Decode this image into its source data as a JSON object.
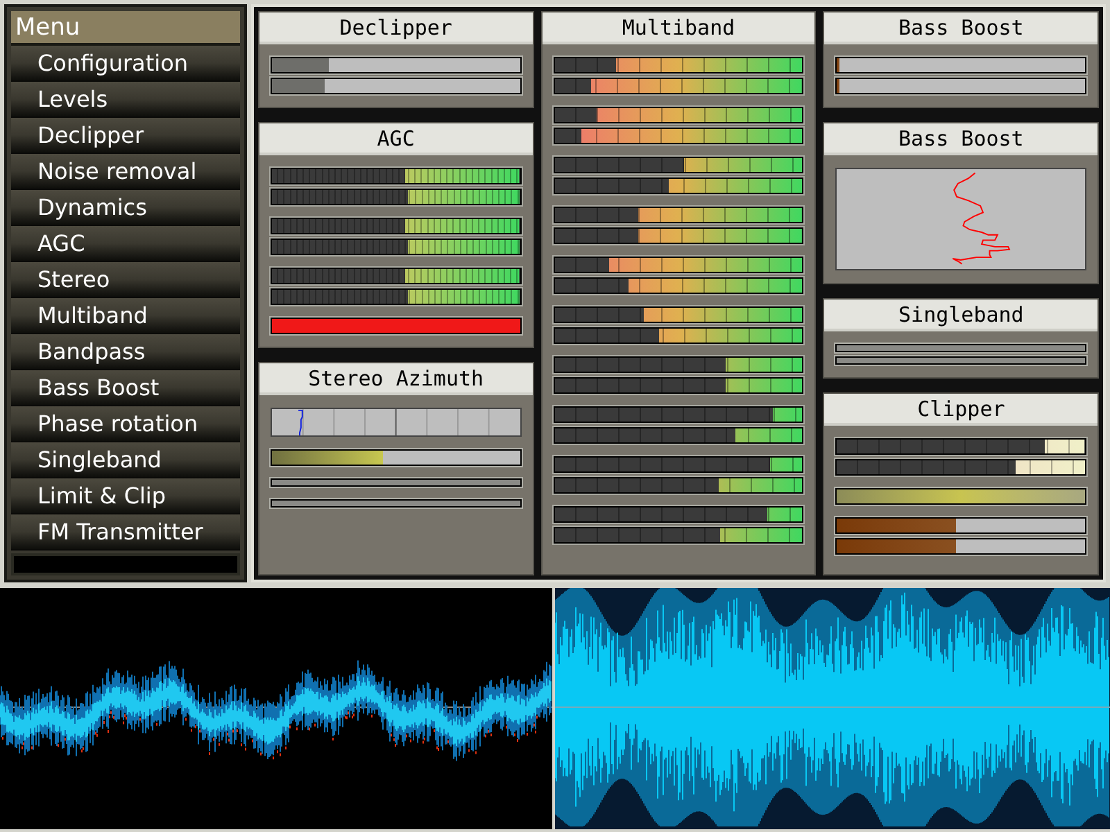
{
  "menu": {
    "title": "Menu",
    "items": [
      "Configuration",
      "Levels",
      "Declipper",
      "Noise removal",
      "Dynamics",
      "AGC",
      "Stereo",
      "Multiband",
      "Bandpass",
      "Bass Boost",
      "Phase rotation",
      "Singleband",
      "Limit & Clip",
      "FM Transmitter"
    ]
  },
  "columns": [
    [
      {
        "title": "Declipper",
        "groups": [
          [
            {
              "kind": "grey",
              "level": 0.23
            },
            {
              "kind": "grey",
              "level": 0.21
            }
          ]
        ]
      },
      {
        "title": "AGC",
        "groups": [
          [
            {
              "kind": "fine",
              "level": 0.46
            },
            {
              "kind": "fine",
              "level": 0.45
            }
          ],
          [
            {
              "kind": "fine",
              "level": 0.46
            },
            {
              "kind": "fine",
              "level": 0.45
            }
          ],
          [
            {
              "kind": "fine",
              "level": 0.46
            },
            {
              "kind": "fine",
              "level": 0.45
            }
          ],
          [
            {
              "kind": "red",
              "level": 1
            }
          ]
        ]
      },
      {
        "title": "Stereo Azimuth",
        "groups": [
          [
            {
              "kind": "scope"
            }
          ],
          [
            {
              "kind": "yellow",
              "level": 0.45
            }
          ],
          [
            {
              "kind": "empty"
            }
          ],
          [
            {
              "kind": "empty"
            }
          ]
        ]
      }
    ],
    [
      {
        "title": "Multiband",
        "groups": [
          [
            {
              "kind": "segmented",
              "level": 0.75
            },
            {
              "kind": "segmented",
              "level": 0.85
            }
          ],
          [
            {
              "kind": "segmented",
              "level": 0.83
            },
            {
              "kind": "segmented",
              "level": 0.89
            }
          ],
          [
            {
              "kind": "segmented",
              "level": 0.48
            },
            {
              "kind": "segmented",
              "level": 0.54
            }
          ],
          [
            {
              "kind": "segmented",
              "level": 0.66
            },
            {
              "kind": "segmented",
              "level": 0.66
            }
          ],
          [
            {
              "kind": "segmented",
              "level": 0.78
            },
            {
              "kind": "segmented",
              "level": 0.7
            }
          ],
          [
            {
              "kind": "segmented",
              "level": 0.64
            },
            {
              "kind": "segmented",
              "level": 0.58
            }
          ],
          [
            {
              "kind": "segmented",
              "level": 0.31
            },
            {
              "kind": "segmented",
              "level": 0.31
            }
          ],
          [
            {
              "kind": "segmented",
              "level": 0.12
            },
            {
              "kind": "segmented",
              "level": 0.27
            }
          ],
          [
            {
              "kind": "segmented",
              "level": 0.13
            },
            {
              "kind": "segmented",
              "level": 0.34
            }
          ],
          [
            {
              "kind": "segmented",
              "level": 0.14
            },
            {
              "kind": "segmented",
              "level": 0.33
            }
          ]
        ]
      }
    ],
    [
      {
        "title": "Bass Boost",
        "groups": [
          [
            {
              "kind": "brown",
              "level": 0.01
            },
            {
              "kind": "brown",
              "level": 0.01
            }
          ]
        ]
      },
      {
        "title": "Bass Boost",
        "groups": [
          [
            {
              "kind": "curve"
            }
          ]
        ]
      },
      {
        "title": "Singleband",
        "groups": [
          [
            {
              "kind": "empty"
            },
            {
              "kind": "empty"
            }
          ]
        ]
      },
      {
        "title": "Clipper",
        "groups": [
          [
            {
              "kind": "pale",
              "level": 0.16
            },
            {
              "kind": "pale",
              "level": 0.28
            }
          ],
          [
            {
              "kind": "olive",
              "level": 1
            }
          ],
          [
            {
              "kind": "brown",
              "level": 0.48
            },
            {
              "kind": "brown",
              "level": 0.48
            }
          ]
        ]
      }
    ]
  ]
}
